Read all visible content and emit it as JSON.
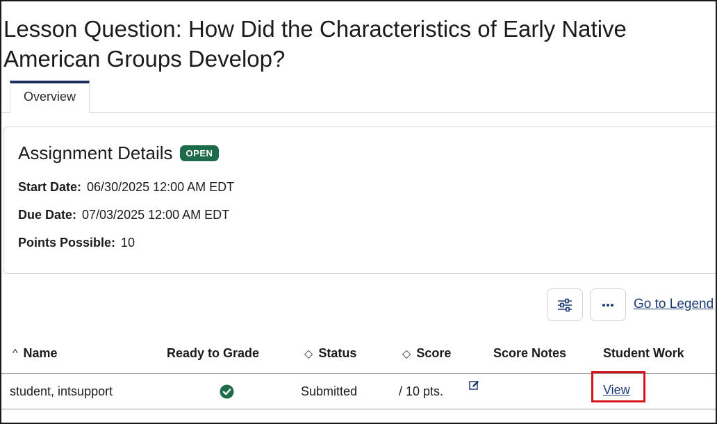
{
  "page": {
    "title": "Lesson Question: How Did the Characteristics of Early Native American Groups Develop?"
  },
  "tabs": [
    {
      "label": "Overview",
      "active": true
    }
  ],
  "assignment": {
    "heading": "Assignment Details",
    "status_badge": "OPEN",
    "status_color": "#1e6b4a",
    "start_label": "Start Date:",
    "start_value": "06/30/2025 12:00 AM EDT",
    "due_label": "Due Date:",
    "due_value": "07/03/2025 12:00 AM EDT",
    "points_label": "Points Possible:",
    "points_value": "10"
  },
  "toolbar": {
    "filter_icon": "sliders-icon",
    "more_icon": "ellipsis-icon",
    "legend_link": "Go to Legend"
  },
  "table": {
    "columns": [
      {
        "label": "Name",
        "sort_icon": "chevron-up-icon",
        "glyph": "^"
      },
      {
        "label": "Ready to Grade"
      },
      {
        "label": "Status",
        "sort_icon": "sort-icon",
        "glyph": "◇"
      },
      {
        "label": "Score",
        "sort_icon": "sort-icon",
        "glyph": "◇"
      },
      {
        "label": "Score Notes"
      },
      {
        "label": "Student Work"
      }
    ],
    "rows": [
      {
        "name": "student, intsupport",
        "ready_icon": "check-circle-icon",
        "status": "Submitted",
        "score": "/ 10 pts.",
        "score_edit_icon": "edit-icon",
        "score_notes": "",
        "student_work_link": "View"
      }
    ]
  },
  "colors": {
    "accent_tab": "#1d2f5e",
    "link": "#1d3a73",
    "highlight": "#d4141c",
    "success": "#1e6b4a"
  }
}
